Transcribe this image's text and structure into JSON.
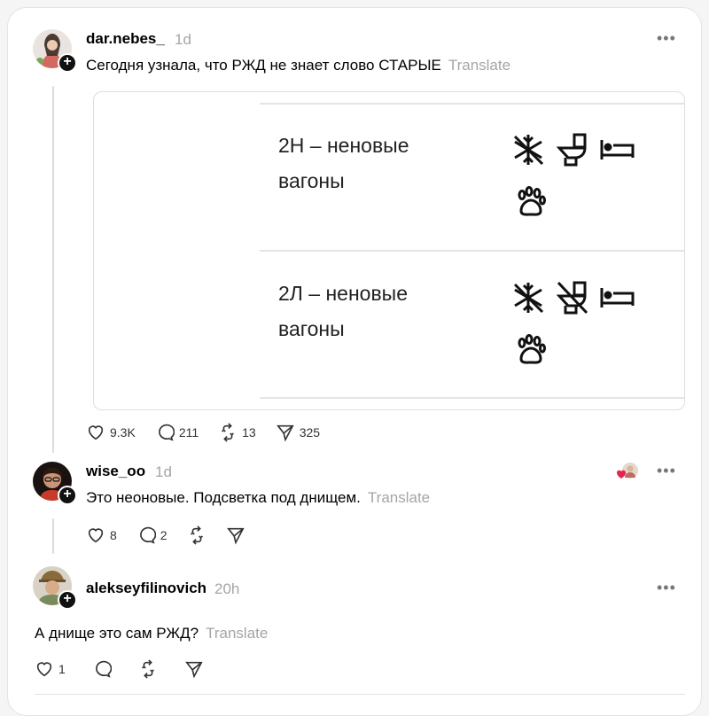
{
  "posts": [
    {
      "username": "dar.nebes_",
      "time": "1d",
      "text": "Сегодня узнала, что РЖД не знает слово СТАРЫЕ",
      "translate": "Translate",
      "actions": {
        "likes": "9.3K",
        "replies": "211",
        "reposts": "13",
        "shares": "325"
      }
    },
    {
      "username": "wise_oo",
      "time": "1d",
      "text": "Это неоновые. Подсветка под днищем.",
      "translate": "Translate",
      "actions": {
        "likes": "8",
        "replies": "2",
        "reposts": "",
        "shares": ""
      }
    },
    {
      "username": "alekseyfilinovich",
      "time": "20h",
      "text": "А днище это сам РЖД?",
      "translate": "Translate",
      "actions": {
        "likes": "1",
        "replies": "",
        "reposts": "",
        "shares": ""
      }
    }
  ],
  "media": {
    "rows": [
      {
        "line1": "2Н – неновые",
        "line2": "вагоны",
        "icons": [
          "snowflake-crossed-icon",
          "toilet-icon",
          "bed-icon",
          "paw-icon"
        ]
      },
      {
        "line1": "2Л – неновые",
        "line2": "вагоны",
        "icons": [
          "snowflake-crossed-icon",
          "toilet-crossed-icon",
          "bed-icon",
          "paw-icon"
        ]
      }
    ]
  },
  "colors": {
    "muted": "#a5a5a5",
    "like_heart": "#e8224a"
  }
}
